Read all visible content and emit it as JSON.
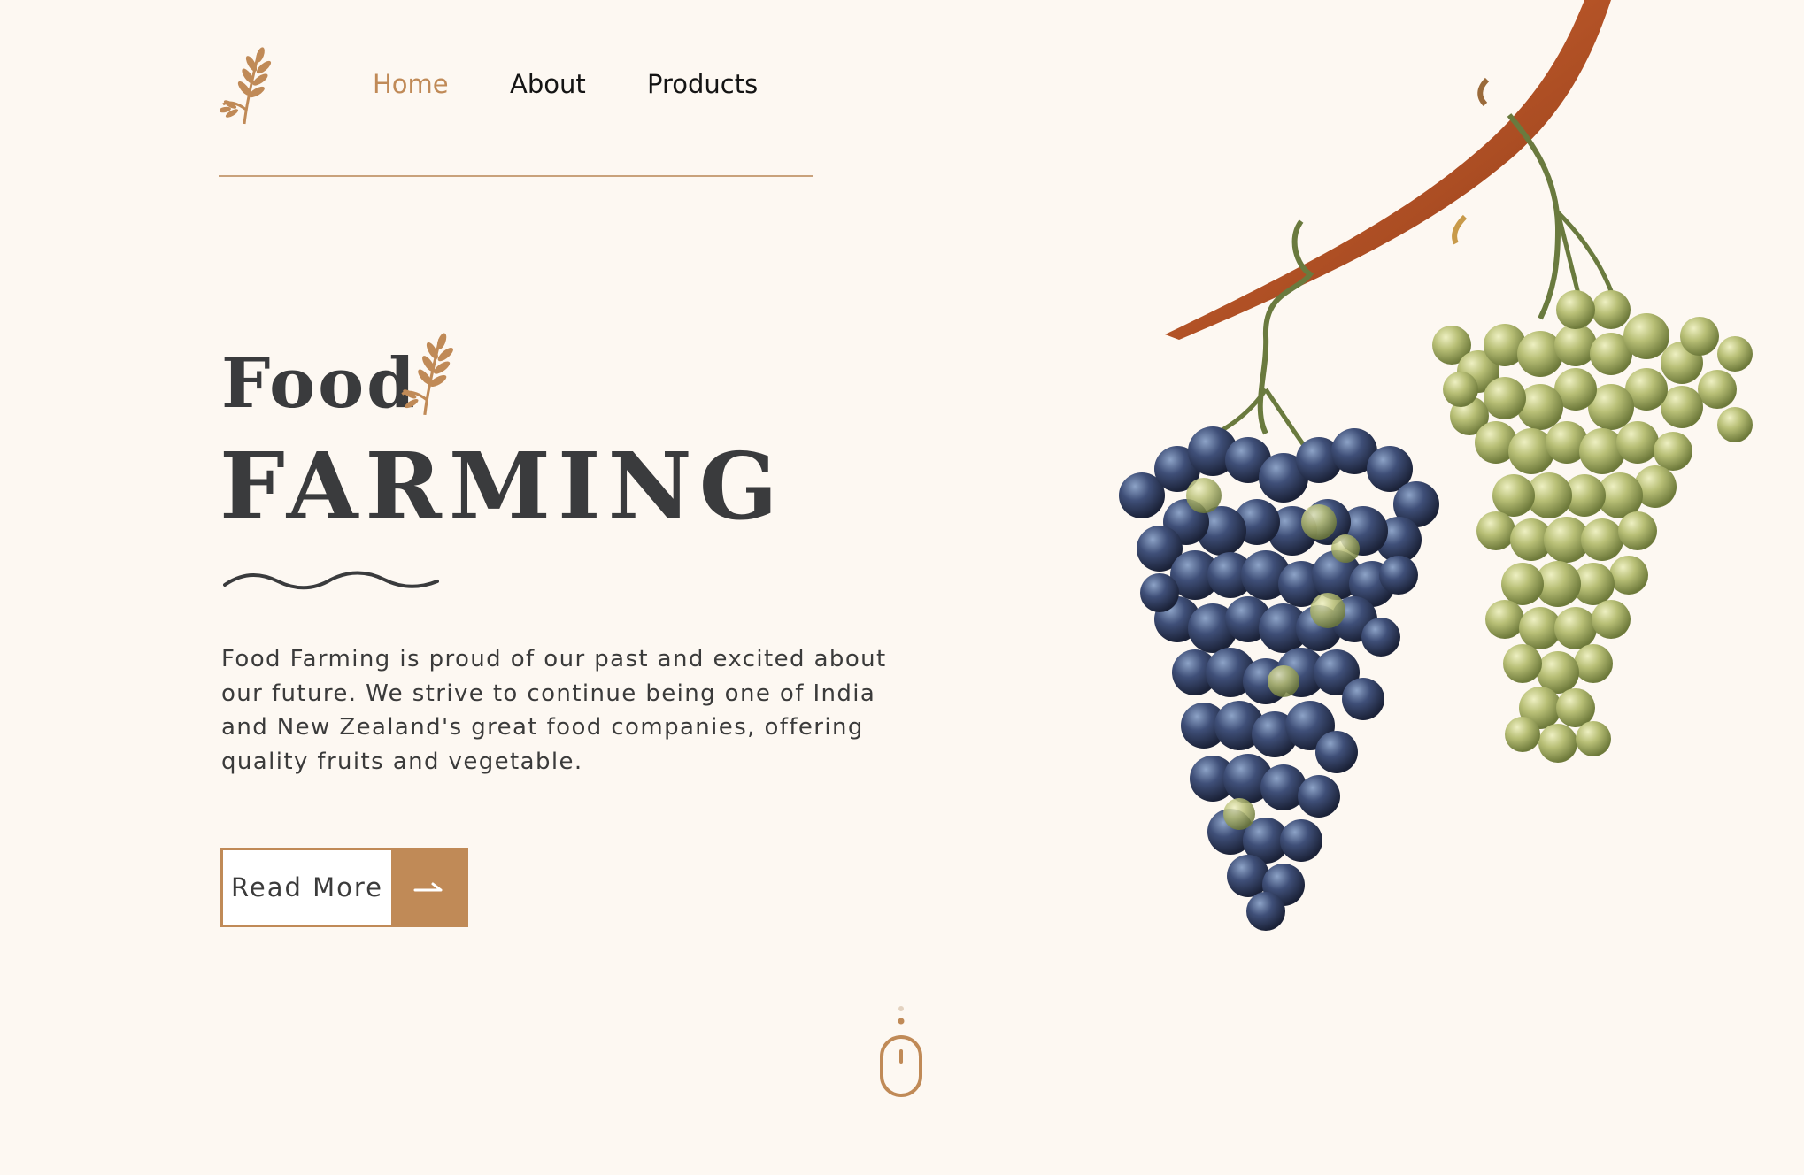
{
  "nav": {
    "items": [
      {
        "label": "Home",
        "active": true
      },
      {
        "label": "About",
        "active": false
      },
      {
        "label": "Products",
        "active": false
      }
    ]
  },
  "hero": {
    "title_small": "Food",
    "title_large": "FARMING",
    "description": "Food Farming is proud of our past and excited about our future. We strive to continue being one of India and New Zealand's great food companies, offering quality fruits and vegetable.",
    "cta_label": "Read More"
  },
  "colors": {
    "background": "#fdf8f2",
    "accent": "#c08a57",
    "heading": "#3a3b3d"
  },
  "icons": {
    "logo": "wheat-icon",
    "title_icon": "wheat-icon",
    "cta_icon": "arrow-right-icon",
    "scroll_indicator": "mouse-icon"
  }
}
